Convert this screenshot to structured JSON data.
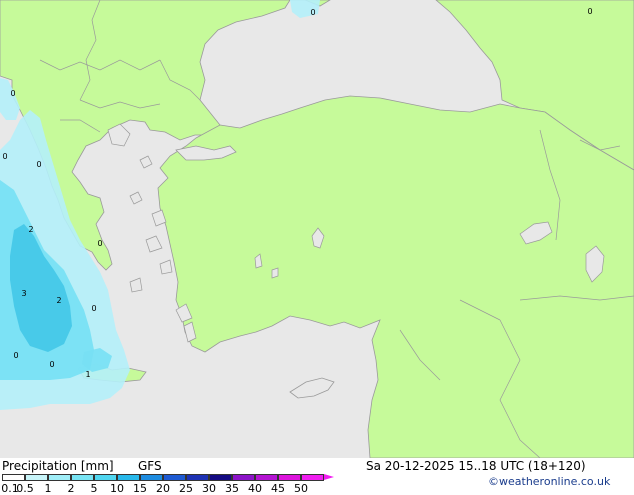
{
  "title": "Precipitation [mm]",
  "model": "GFS",
  "datetime": "Sa 20-12-2025 15..18 UTC (18+120)",
  "credit": "©weatheronline.co.uk",
  "colors": {
    "sea": "#e8e8e8",
    "land": "#c6fa9a",
    "border": "#9a9a9a",
    "precip_light": "#b4f0fa",
    "precip_mid": "#78e0f4",
    "precip_heavy": "#46c8e8"
  },
  "legend": {
    "ticks": [
      "0.1",
      "0.5",
      "1",
      "2",
      "5",
      "10",
      "15",
      "20",
      "25",
      "30",
      "35",
      "40",
      "45",
      "50"
    ],
    "colors": [
      "#ffffff",
      "#c8f5fa",
      "#a0eef8",
      "#78e4f4",
      "#50d6f0",
      "#28b8ea",
      "#1e8ce0",
      "#1e5ad2",
      "#1e32b4",
      "#140a82",
      "#8c14c8",
      "#b414d2",
      "#dc14dc",
      "#f01ef0"
    ]
  },
  "station_values": [
    {
      "id": "s1",
      "value": "0"
    },
    {
      "id": "s2",
      "value": "0"
    },
    {
      "id": "s3",
      "value": "0"
    },
    {
      "id": "s4",
      "value": "0"
    },
    {
      "id": "s5",
      "value": "2"
    },
    {
      "id": "s6",
      "value": "0"
    },
    {
      "id": "s7",
      "value": "3"
    },
    {
      "id": "s8",
      "value": "2"
    },
    {
      "id": "s9",
      "value": "0"
    },
    {
      "id": "s10",
      "value": "0"
    },
    {
      "id": "s11",
      "value": "0"
    },
    {
      "id": "s12",
      "value": "1"
    },
    {
      "id": "s13",
      "value": "0"
    }
  ]
}
